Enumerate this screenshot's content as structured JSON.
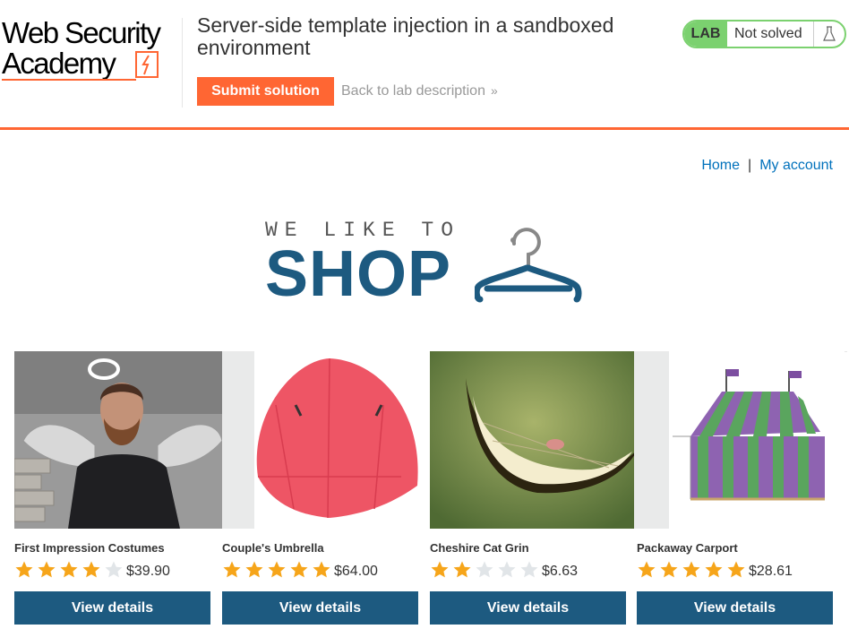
{
  "header": {
    "logo_line1": "Web Security",
    "logo_line2": "Academy",
    "lab_title": "Server-side template injection in a sandboxed environment",
    "submit_label": "Submit solution",
    "back_label": "Back to lab description",
    "status_lab": "LAB",
    "status_text": "Not solved"
  },
  "nav": {
    "home": "Home",
    "separator": "|",
    "account": "My account"
  },
  "banner": {
    "tagline": "WE LIKE TO",
    "word": "SHOP"
  },
  "products": [
    {
      "name": "First Impression Costumes",
      "rating": 4,
      "price": "$39.90",
      "button": "View details",
      "image": "man-with-angel-wings-photo"
    },
    {
      "name": "Couple's Umbrella",
      "rating": 5,
      "price": "$64.00",
      "button": "View details",
      "image": "red-umbrella-photo"
    },
    {
      "name": "Cheshire Cat Grin",
      "rating": 2,
      "price": "$6.63",
      "button": "View details",
      "image": "cheshire-grin-photo"
    },
    {
      "name": "Packaway Carport",
      "rating": 5,
      "price": "$28.61",
      "button": "View details",
      "image": "striped-tent-photo"
    }
  ],
  "colors": {
    "accent": "#ff6633",
    "brand_blue": "#1d5a80",
    "link": "#0071bc",
    "lab_green": "#7bd16f",
    "star_on": "#f6a51a",
    "star_off": "#e1e5e8"
  }
}
